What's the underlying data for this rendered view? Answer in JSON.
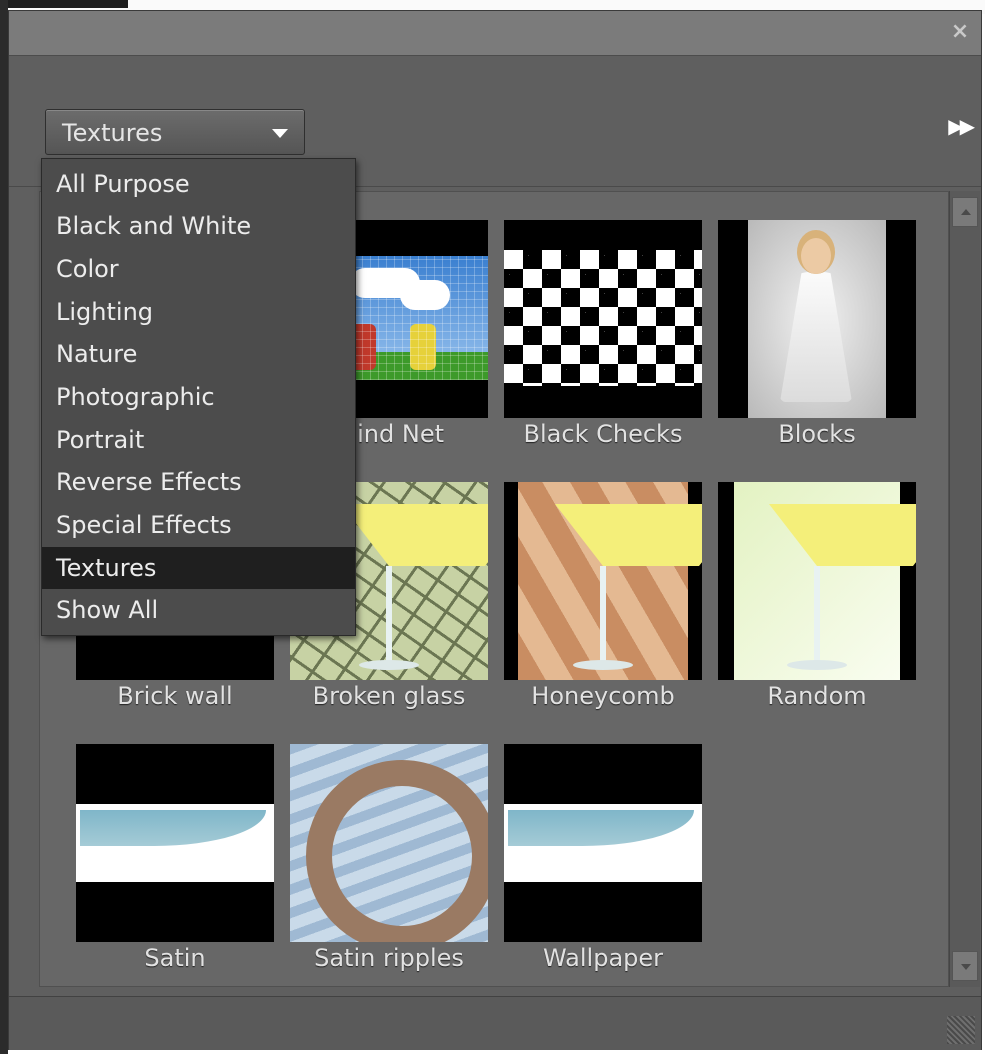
{
  "panel": {
    "close_icon": "close-icon",
    "dropdown_value": "Textures",
    "expand_icon": "fast-forward-icon"
  },
  "menu": {
    "items": [
      {
        "label": "All Purpose"
      },
      {
        "label": "Black and White"
      },
      {
        "label": "Color"
      },
      {
        "label": "Lighting"
      },
      {
        "label": "Nature"
      },
      {
        "label": "Photographic"
      },
      {
        "label": "Portrait"
      },
      {
        "label": "Reverse Effects"
      },
      {
        "label": "Special Effects"
      },
      {
        "label": "Textures",
        "selected": true
      },
      {
        "label": "Show All"
      }
    ]
  },
  "thumbnails": [
    {
      "label": "Blind Net"
    },
    {
      "label": "Black Checks"
    },
    {
      "label": "Blocks"
    },
    {
      "label": "Brick wall"
    },
    {
      "label": "Broken glass"
    },
    {
      "label": "Honeycomb"
    },
    {
      "label": "Random"
    },
    {
      "label": "Satin"
    },
    {
      "label": "Satin ripples"
    },
    {
      "label": "Wallpaper"
    }
  ],
  "colors": {
    "panel_bg": "#5f5f5f",
    "menu_bg": "#4c4c4c",
    "menu_selected": "#1f1f1f"
  }
}
